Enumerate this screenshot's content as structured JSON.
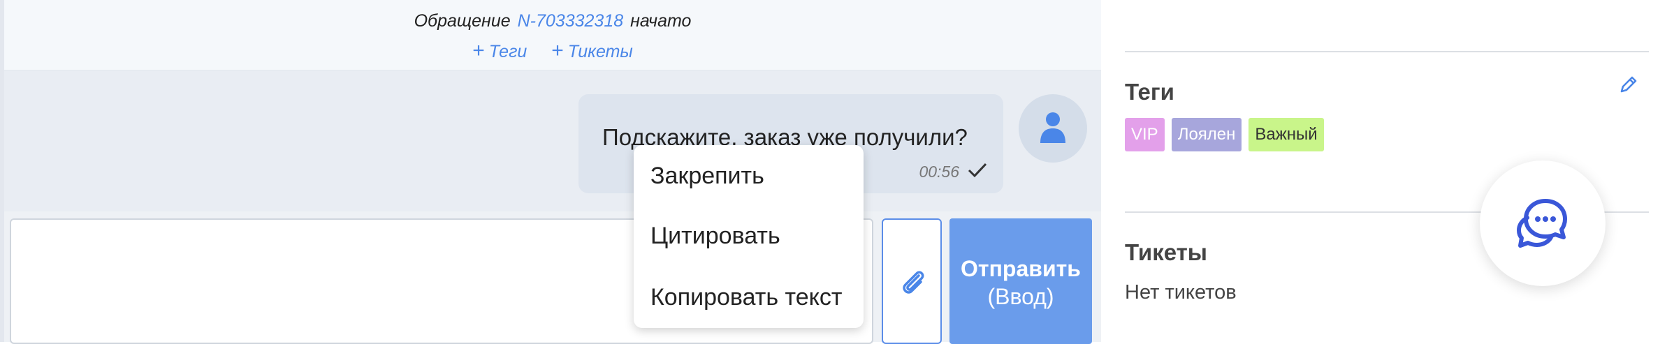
{
  "chat": {
    "banner": {
      "prefix": "Обращение",
      "ticket_id": "N-703332318",
      "suffix": "начато",
      "add_tags": "Теги",
      "add_tickets": "Тикеты",
      "plus": "+"
    },
    "message": {
      "text": "Подскажите, заказ уже получили?",
      "time": "00:56",
      "status": "sent"
    },
    "context_menu": {
      "items": [
        "Закрепить",
        "Цитировать",
        "Копировать текст"
      ]
    },
    "composer": {
      "placeholder": "",
      "send_label": "Отправить",
      "send_hint": "(Ввод)"
    }
  },
  "sidebar": {
    "tags_title": "Теги",
    "tags": [
      {
        "label": "VIP",
        "bg": "#e3a0ea",
        "fg": "#ffffff"
      },
      {
        "label": "Лоялен",
        "bg": "#a7a6dc",
        "fg": "#ffffff"
      },
      {
        "label": "Важный",
        "bg": "#c9f58a",
        "fg": "#333333"
      }
    ],
    "tickets_title": "Тикеты",
    "tickets_empty": "Нет тикетов"
  },
  "colors": {
    "accent": "#4a86e8",
    "send_button": "#6a9ceb",
    "chat_bg": "#e9edf3",
    "bubble": "#dde4ee"
  },
  "icons": {
    "avatar": "user-icon",
    "attach": "paperclip-icon",
    "edit": "pencil-icon",
    "widget": "chat-bubble-icon",
    "delivered": "checkmark-icon"
  }
}
